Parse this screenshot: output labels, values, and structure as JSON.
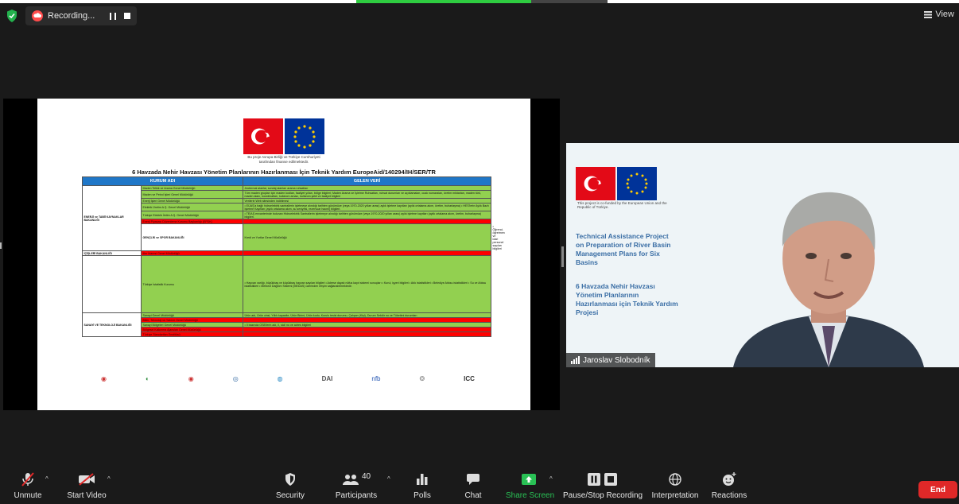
{
  "recording": {
    "label": "Recording..."
  },
  "view_label": "View",
  "slide": {
    "flag_caption_line1": "Bu proje Avrupa Birliği ve Türkiye Cumhuriyeti",
    "flag_caption_line2": "tarafından finanse edilmektedir.",
    "title": "6 Havzada Nehir Havzası Yönetim Planlarının Hazırlanması İçin Teknik Yardım EuropeAid/140294/IH/SER/TR",
    "table_headers": [
      "KURUM ADI",
      "GELEN VERİ"
    ],
    "rows": [
      {
        "cat": "ENERJİ ve TABİİ KAYNAKLAR BAKANLIĞI",
        "catspan": 7,
        "kurum": "Maden Tetkik ve Arama Genel Müdürlüğü",
        "veri": "Jeotermal alanlar, sondaj alanları arama ruhsatları",
        "status": "g"
      },
      {
        "kurum": "Maden ve Petrol İşleri Genel Müdürlüğü",
        "veri": "Tüm maden grupları için maden kodları, faaliyet yılları, bölge bilgileri; Maden Arama ve İşletme Ruhsatları, ruhsat durumları ve açıklamaları, ocak numaraları, üretim miktarları, maden türü, maden alanı, koordinatları, kullanım amacı, kullanım şekli ve faaliyet bilgileri",
        "status": "g"
      },
      {
        "kurum": "Enerji İşleri Genel Müdürlüğü",
        "veri": "Verilerin Web sitesinden indirilmesi",
        "status": "g"
      },
      {
        "kurum": "Elektrik Üretim A.Ş. Genel Müdürlüğü",
        "veri": "• EÜAŞ'a bağlı hidroelektrik santrallerin işletmeye alındığı tarihten günümüze (veya 1970-2020 yılları arası) aylık işletme kayıtları (aylık ortalama akım, üretim, buharlaşma) • HES'lerin Aylık Bazlı İşletme Kayıtları (aylık ortalama akım, su seviyesi, rezervuar hacmi) bilgileri.",
        "status": "g"
      },
      {
        "kurum": "Türkiye Elektrik İletim A.Ş. Genel Müdürlüğü",
        "veri": "• TEİAŞ envanterinde bulunan Hidroelektrik Santrallerin işletmeye alındığı tarihten günümüze (veya 1970-2020 yılları arası) aylık işletme kayıtları (aylık ortalama akım, üretim, buharlaşma) bilgileri.",
        "status": "g"
      },
      {
        "kurum": "Enerji Piyasası Düzenleme Kurumu Başkanlığı (EPDK)",
        "veri": "",
        "status": "r"
      },
      {
        "cat": "GENÇLİK ve SPOR BAKANLIĞI",
        "catspan": 1,
        "kurum": "Kredi ve Yurtlar Genel Müdürlüğü",
        "veri": "• Öğrenci, öğretmen ve idari personel sayıları bilgileri",
        "status": "g"
      },
      {
        "cat": "İÇİŞLERİ BAKANLIĞI",
        "catspan": 1,
        "kurum": "İller İdaresi Genel Müdürlüğü",
        "veri": "",
        "status": "r"
      },
      {
        "cat": "",
        "catspan": 1,
        "kurum": "Türkiye İstatistik Kurumu",
        "veri": "• Hayvan varlığı, büyükbaş ve küçükbaş hayvan sayıları bilgileri • Adrese dayalı nüfus kayıt sistemi sonuçları • Kurul, işyeri bilgileri • Atık istatistikleri • Belediye Atıksu istatistikleri • Su ve Atıksu istatistikleri • Merkezi Dağıtım Sistemi (MEDAS) üzerinden erişim sağlanabilmektedir.",
        "status": "g"
      },
      {
        "cat": "SANAYİ VE TEKNOLOJİ BAKANLIĞI",
        "catspan": 5,
        "kurum": "Sanayi Genel Müdürlüğü",
        "veri": "Ürün adı, Ürün cinsi, Yıllık kapasite, Ürün Birimi, Ürün kodu, Kurulu tesisi durumu, Çalışan (Kişi), Durum Sektör no ve Tüketimi durumları",
        "status": "g"
      },
      {
        "kurum": "Bilim, Teknoloji ve Yatırım Genel Müdürlüğü",
        "veri": "",
        "status": "r"
      },
      {
        "kurum": "Sanayi Bölgeleri Genel Müdürlüğü",
        "veri": "• İl bazında OSB'lerin adı, il, sicil no ve adres bilgileri",
        "status": "g"
      },
      {
        "kurum": "Bölgesel Kalkınma Ajansları Genel Müdürlüğü",
        "veri": "",
        "status": "r"
      },
      {
        "kurum": "Türkiye Standartları Enstitüsü",
        "veri": "",
        "status": "r"
      }
    ],
    "logo_texts": [
      "DAI",
      "nfb",
      "ICC"
    ]
  },
  "camera": {
    "flag_caption": "This project is co-funded by the European Union and the Republic of Türkiye.",
    "title_en": "Technical Assistance Project on Preparation of River Basin Management Plans for Six Basins",
    "title_tr": "6 Havzada Nehir Havzası Yönetim Planlarının Hazırlanması için Teknik Yardım Projesi",
    "participant_name": "Jaroslav Slobodník"
  },
  "toolbar": {
    "unmute": "Unmute",
    "start_video": "Start Video",
    "security": "Security",
    "participants": "Participants",
    "participants_count": "40",
    "polls": "Polls",
    "chat": "Chat",
    "share_screen": "Share Screen",
    "pause_stop_recording": "Pause/Stop Recording",
    "interpretation": "Interpretation",
    "reactions": "Reactions",
    "end": "End"
  },
  "colors": {
    "accent_green": "#29c155",
    "end_red": "#e02828",
    "table_header_blue": "#1f77c8",
    "row_green": "#92d050",
    "row_red": "#ff0000"
  }
}
